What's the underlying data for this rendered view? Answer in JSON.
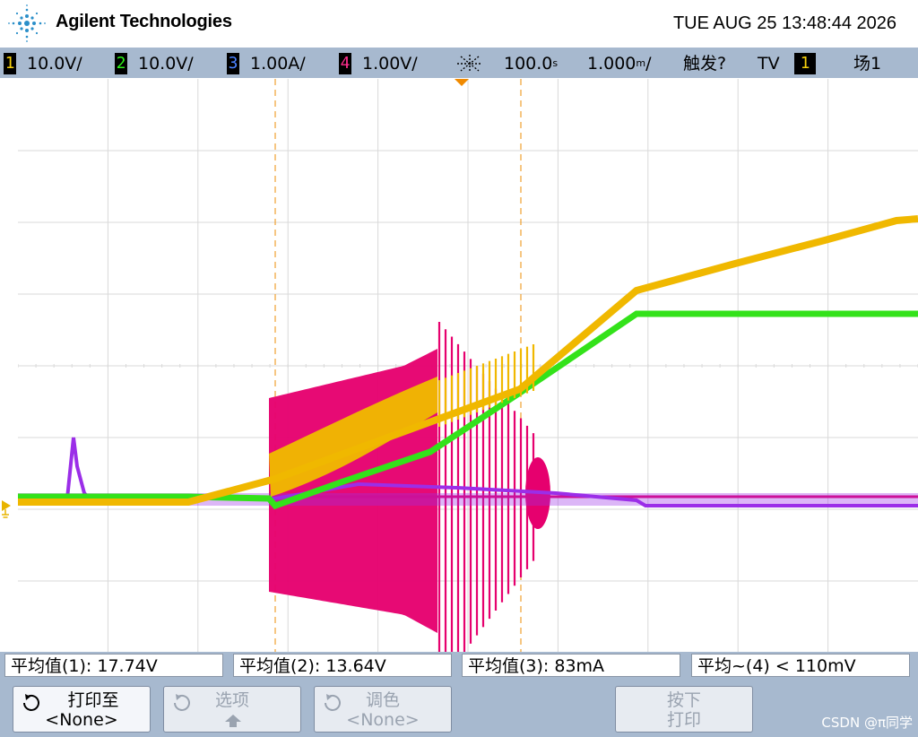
{
  "header": {
    "brand": "Agilent Technologies",
    "datetime": "TUE AUG 25 13:48:44 2026"
  },
  "status": {
    "channels": [
      {
        "num": "1",
        "scale": "10.0V/",
        "color": "#f6d10c"
      },
      {
        "num": "2",
        "scale": "10.0V/",
        "color": "#2ef21a"
      },
      {
        "num": "3",
        "scale": "1.00A/",
        "color": "#4b83ff"
      },
      {
        "num": "4",
        "scale": "1.00V/",
        "color": "#ff2f8e"
      }
    ],
    "delay": "100.0",
    "delay_unit": "s",
    "timebase": "1.000",
    "timebase_unit": "/",
    "trigger_label": "触发?",
    "trigger_mode": "TV",
    "trigger_channel": "1",
    "field": "场1"
  },
  "measurements": [
    {
      "label": "平均值(1): 17.74V"
    },
    {
      "label": "平均值(2): 13.64V"
    },
    {
      "label": "平均值(3): 83mA"
    },
    {
      "label": "平均~(4) < 110mV"
    }
  ],
  "softkeys": {
    "print_to": {
      "line1": "打印至",
      "line2": "<None>"
    },
    "options": {
      "line1": "选项"
    },
    "color": {
      "line1": "调色",
      "line2": "<None>"
    },
    "press_print": {
      "line1": "按下",
      "line2": "打印"
    }
  },
  "watermark": "CSDN @π同学",
  "colors": {
    "ch1": "#f0b800",
    "ch2": "#33e21a",
    "ch3": "#9b2ee8",
    "ch4": "#e6006e",
    "grid": "#d9d9d9",
    "cursor": "#f0a030",
    "panel": "#a7b9cf"
  }
}
